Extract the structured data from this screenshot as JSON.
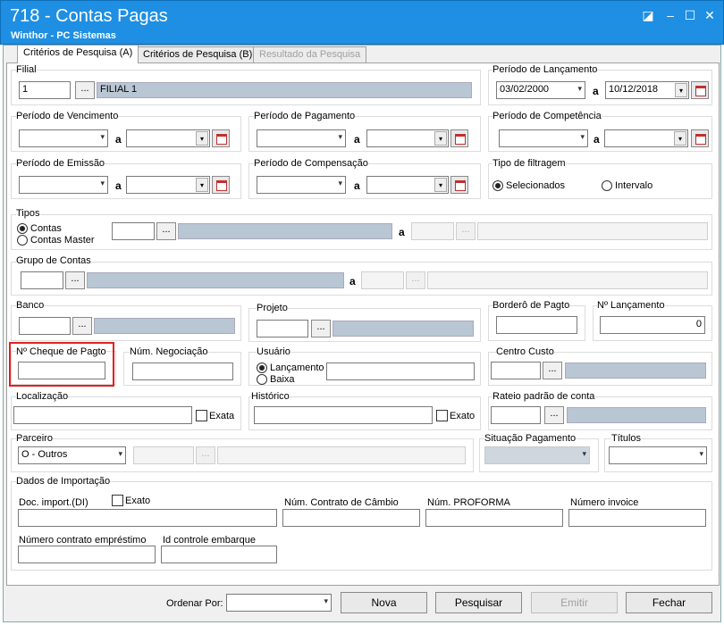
{
  "window": {
    "title": "718 - Contas Pagas",
    "subtitle": "Winthor - PC Sistemas"
  },
  "tabs": [
    {
      "label": "Critérios de Pesquisa (A)"
    },
    {
      "label": "Critérios de Pesquisa (B)"
    },
    {
      "label": "Resultado da Pesquisa"
    }
  ],
  "filial": {
    "label": "Filial",
    "code": "1",
    "name": "FILIAL 1"
  },
  "periodo_lancamento": {
    "label": "Período de Lançamento",
    "from": "03/02/2000",
    "a": "a",
    "to": "10/12/2018"
  },
  "periodo_vencimento": {
    "label": "Período de Vencimento"
  },
  "periodo_pagamento": {
    "label": "Período de Pagamento"
  },
  "periodo_competencia": {
    "label": "Período de Competência"
  },
  "periodo_emissao": {
    "label": "Período de Emissão"
  },
  "periodo_compensacao": {
    "label": "Período de Compensação"
  },
  "a": "a",
  "tipo_filtragem": {
    "label": "Tipo de filtragem",
    "opt1": "Selecionados",
    "opt2": "Intervalo"
  },
  "tipos": {
    "label": "Tipos",
    "opt1": "Contas",
    "opt2": "Contas Master"
  },
  "grupo_contas": {
    "label": "Grupo de Contas"
  },
  "banco": {
    "label": "Banco"
  },
  "projeto": {
    "label": "Projeto"
  },
  "bordero": {
    "label": "Borderô de Pagto"
  },
  "n_lancamento": {
    "label": "Nº Lançamento",
    "value": "0"
  },
  "n_cheque": {
    "label": "Nº Cheque de Pagto"
  },
  "num_negociacao": {
    "label": "Núm. Negociação"
  },
  "usuario": {
    "label": "Usuário",
    "opt1": "Lançamento",
    "opt2": "Baixa"
  },
  "centro_custo": {
    "label": "Centro Custo"
  },
  "localizacao": {
    "label": "Localização",
    "exato": "Exata"
  },
  "historico": {
    "label": "Histórico",
    "exato": "Exato"
  },
  "rateio": {
    "label": "Rateio padrão de conta"
  },
  "parceiro": {
    "label": "Parceiro",
    "value": "O - Outros"
  },
  "situacao_pagamento": {
    "label": "Situação Pagamento"
  },
  "titulos": {
    "label": "Títulos"
  },
  "dados_importacao": {
    "label": "Dados de Importação",
    "doc": "Doc. import.(DI)",
    "exato": "Exato",
    "contrato_cambio": "Núm. Contrato de Câmbio",
    "proforma": "Núm. PROFORMA",
    "invoice": "Número invoice",
    "emprestimo": "Número contrato empréstimo",
    "embarque": "Id controle embarque"
  },
  "footer": {
    "ordenar": "Ordenar Por:",
    "nova": "Nova",
    "pesquisar": "Pesquisar",
    "emitir": "Emitir",
    "fechar": "Fechar"
  },
  "icons": {
    "dots": "...",
    "calendar": "calendar-icon",
    "dropdown": "▾"
  }
}
